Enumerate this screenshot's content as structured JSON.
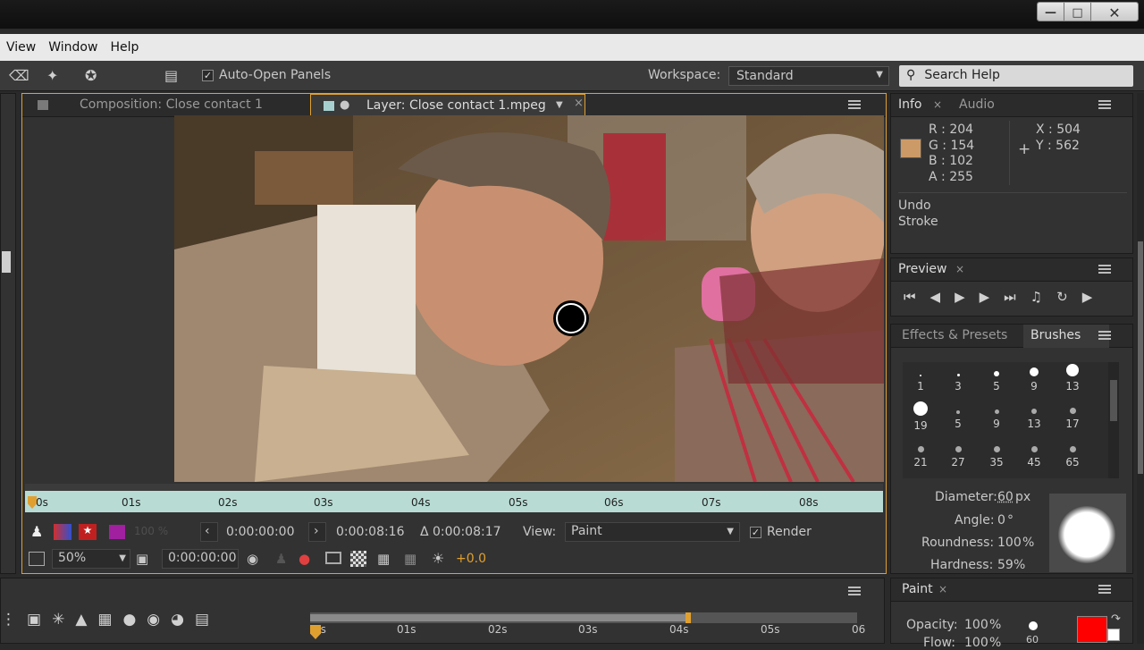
{
  "menu": {
    "items": [
      "View",
      "Window",
      "Help"
    ]
  },
  "toolbar": {
    "auto_open_label": "Auto-Open Panels",
    "workspace_label": "Workspace:",
    "workspace_value": "Standard",
    "search_placeholder": "Search Help"
  },
  "viewer": {
    "tab_composition": "Composition: Close contact 1",
    "tab_layer": "Layer: Close contact 1.mpeg",
    "ruler_ticks": [
      "0s",
      "01s",
      "02s",
      "03s",
      "04s",
      "05s",
      "06s",
      "07s",
      "08s"
    ],
    "opacity_ghost": "100 %",
    "in_time": "0:00:00:00",
    "out_time": "0:00:08:16",
    "duration": "Δ 0:00:08:17",
    "view_label": "View:",
    "view_value": "Paint",
    "render_label": "Render",
    "zoom": "50%",
    "current_time": "0:00:00:00",
    "exposure": "+0.0"
  },
  "info": {
    "tab_info": "Info",
    "tab_audio": "Audio",
    "r": "R : 204",
    "g": "G : 154",
    "b": "B : 102",
    "a": "A : 255",
    "x": "X : 504",
    "y": "Y : 562",
    "swatch_color": "#cc9a66",
    "undo_line1": "Undo",
    "undo_line2": "Stroke"
  },
  "preview": {
    "tab": "Preview"
  },
  "brushes": {
    "tab_effects": "Effects & Presets",
    "tab_brushes": "Brushes",
    "items": [
      "1",
      "3",
      "5",
      "9",
      "13",
      "19",
      "5",
      "9",
      "13",
      "17",
      "21",
      "27",
      "35",
      "45",
      "65"
    ],
    "diameter_label": "Diameter:",
    "diameter_value": "60",
    "diameter_unit": "px",
    "angle_label": "Angle:",
    "angle_value": "0",
    "angle_unit": "°",
    "roundness_label": "Roundness:",
    "roundness_value": "100",
    "roundness_unit": "%",
    "hardness_label": "Hardness:",
    "hardness_value": "59",
    "hardness_unit": "%"
  },
  "timeline": {
    "ticks": [
      "0s",
      "01s",
      "02s",
      "03s",
      "04s",
      "05s",
      "06"
    ]
  },
  "paint": {
    "tab": "Paint",
    "opacity_label": "Opacity:",
    "opacity_value": "100",
    "opacity_unit": "%",
    "flow_label": "Flow:",
    "flow_value": "100",
    "flow_unit": "%",
    "brush_size": "60",
    "fg_color": "#ff0000"
  }
}
